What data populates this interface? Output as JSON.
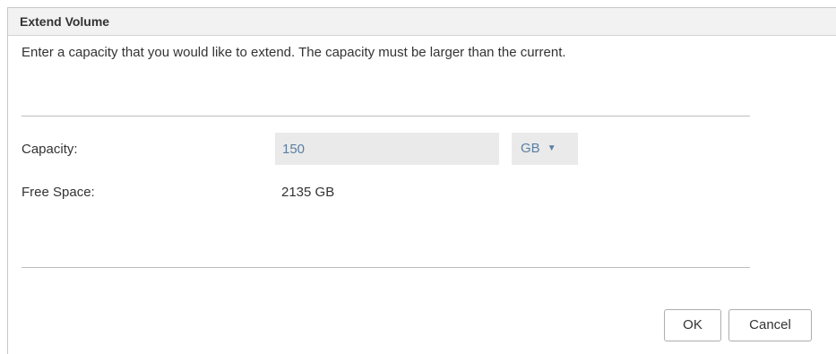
{
  "dialog": {
    "title": "Extend Volume",
    "description": "Enter a capacity that you would like to extend. The capacity must be larger than the current."
  },
  "form": {
    "capacity_label": "Capacity:",
    "capacity_value": "150",
    "unit_selected": "GB",
    "unit_caret_icon": "caret-down-icon",
    "free_space_label": "Free Space:",
    "free_space_value": "2135 GB"
  },
  "buttons": {
    "ok_label": "OK",
    "cancel_label": "Cancel"
  },
  "colors": {
    "titlebar_bg": "#f2f2f2",
    "input_bg": "#eaeaea",
    "input_text": "#5b7fa3",
    "divider": "#bdbdbd"
  }
}
